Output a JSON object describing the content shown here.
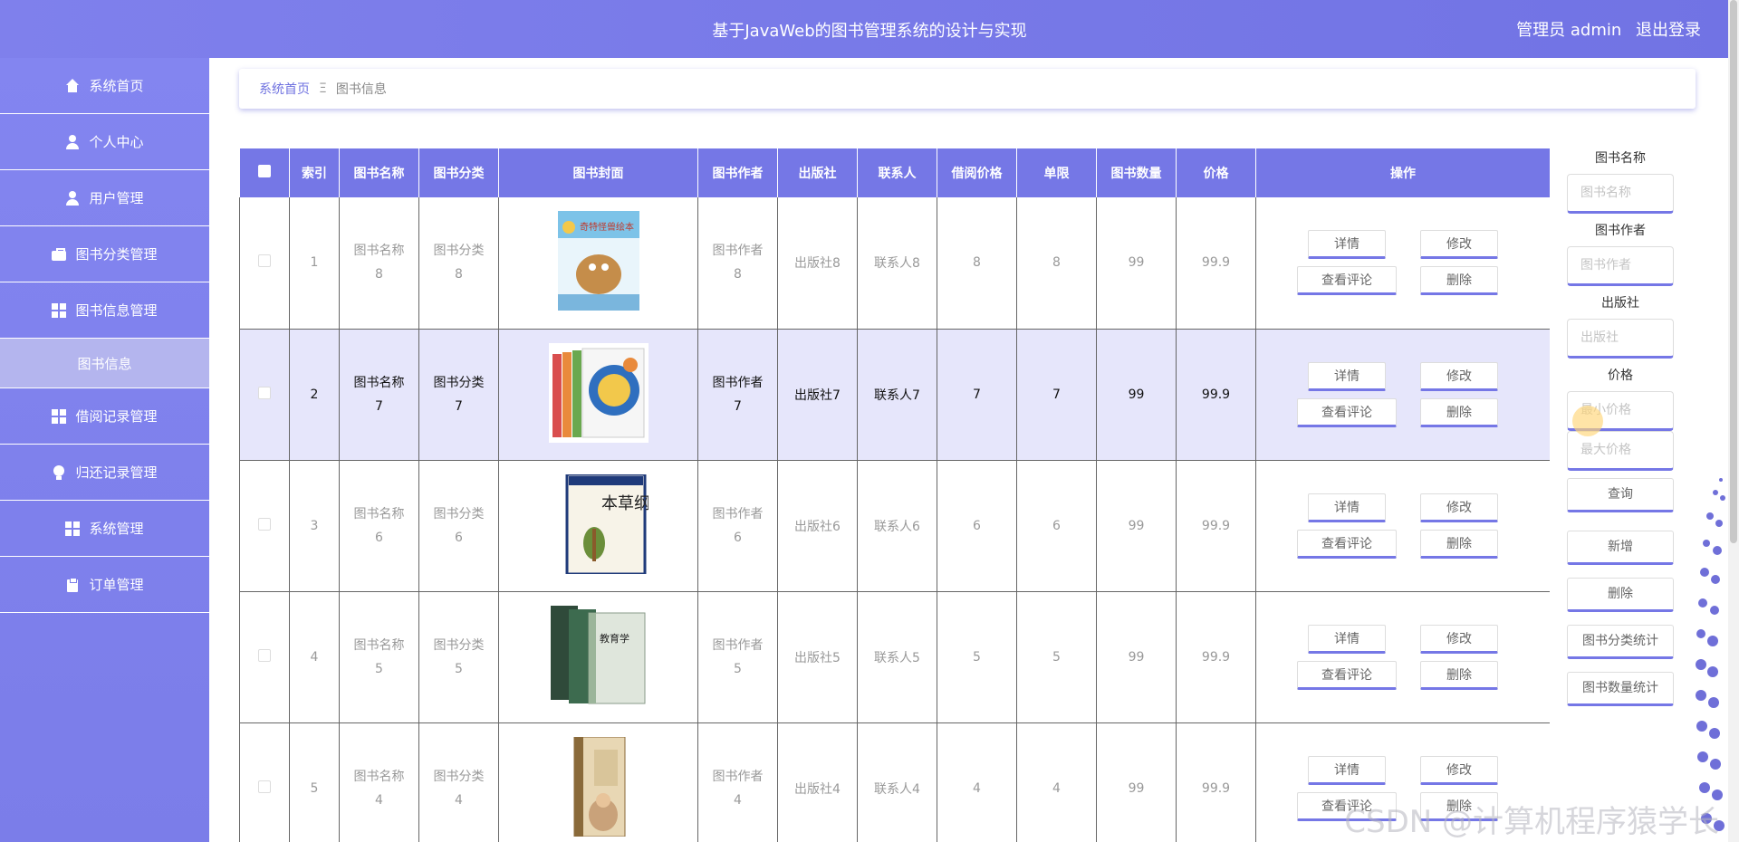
{
  "header": {
    "title": "基于JavaWeb的图书管理系统的设计与实现",
    "user_label": "管理员 admin",
    "logout_label": "退出登录"
  },
  "sidebar": {
    "items": [
      {
        "label": "系统首页",
        "icon": "home-icon"
      },
      {
        "label": "个人中心",
        "icon": "user-icon"
      },
      {
        "label": "用户管理",
        "icon": "user-icon"
      },
      {
        "label": "图书分类管理",
        "icon": "briefcase-icon"
      },
      {
        "label": "图书信息管理",
        "icon": "grid-icon"
      },
      {
        "label": "图书信息",
        "icon": ""
      },
      {
        "label": "借阅记录管理",
        "icon": "grid-icon"
      },
      {
        "label": "归还记录管理",
        "icon": "lightbulb-icon"
      },
      {
        "label": "系统管理",
        "icon": "grid-icon"
      },
      {
        "label": "订单管理",
        "icon": "clipboard-icon"
      }
    ]
  },
  "breadcrumb": {
    "home": "系统首页",
    "separator": "Ξ",
    "current": "图书信息"
  },
  "table": {
    "columns": [
      "索引",
      "图书名称",
      "图书分类",
      "图书封面",
      "图书作者",
      "出版社",
      "联系人",
      "借阅价格",
      "单限",
      "图书数量",
      "价格",
      "操作"
    ],
    "rows": [
      {
        "index": "1",
        "name_a": "图书名称",
        "name_b": "8",
        "cat_a": "图书分类",
        "cat_b": "8",
        "author_a": "图书作者",
        "author_b": "8",
        "publisher": "出版社8",
        "contact": "联系人8",
        "borrow_price": "8",
        "limit": "8",
        "quantity": "99",
        "price": "99.9"
      },
      {
        "index": "2",
        "name_a": "图书名称",
        "name_b": "7",
        "cat_a": "图书分类",
        "cat_b": "7",
        "author_a": "图书作者",
        "author_b": "7",
        "publisher": "出版社7",
        "contact": "联系人7",
        "borrow_price": "7",
        "limit": "7",
        "quantity": "99",
        "price": "99.9"
      },
      {
        "index": "3",
        "name_a": "图书名称",
        "name_b": "6",
        "cat_a": "图书分类",
        "cat_b": "6",
        "author_a": "图书作者",
        "author_b": "6",
        "publisher": "出版社6",
        "contact": "联系人6",
        "borrow_price": "6",
        "limit": "6",
        "quantity": "99",
        "price": "99.9"
      },
      {
        "index": "4",
        "name_a": "图书名称",
        "name_b": "5",
        "cat_a": "图书分类",
        "cat_b": "5",
        "author_a": "图书作者",
        "author_b": "5",
        "publisher": "出版社5",
        "contact": "联系人5",
        "borrow_price": "5",
        "limit": "5",
        "quantity": "99",
        "price": "99.9"
      },
      {
        "index": "5",
        "name_a": "图书名称",
        "name_b": "4",
        "cat_a": "图书分类",
        "cat_b": "4",
        "author_a": "图书作者",
        "author_b": "4",
        "publisher": "出版社4",
        "contact": "联系人4",
        "borrow_price": "4",
        "limit": "4",
        "quantity": "99",
        "price": "99.9"
      }
    ],
    "actions": {
      "detail": "详情",
      "edit": "修改",
      "reviews": "查看评论",
      "delete": "删除"
    }
  },
  "search": {
    "name_label": "图书名称",
    "name_placeholder": "图书名称",
    "author_label": "图书作者",
    "author_placeholder": "图书作者",
    "publisher_label": "出版社",
    "publisher_placeholder": "出版社",
    "price_label": "价格",
    "min_price_placeholder": "最小价格",
    "max_price_placeholder": "最大价格",
    "query_label": "查询",
    "add_label": "新增",
    "delete_label": "删除",
    "cat_stats_label": "图书分类统计",
    "qty_stats_label": "图书数量统计"
  },
  "colors": {
    "accent": "#7577e6",
    "sidebar": "#8385f0",
    "highlight_row": "#e6e6fb"
  },
  "cover_texts": [
    "奇特怪兽绘本",
    "本草纲目",
    "教育学"
  ],
  "watermark": "CSDN @计算机程序猿学长"
}
